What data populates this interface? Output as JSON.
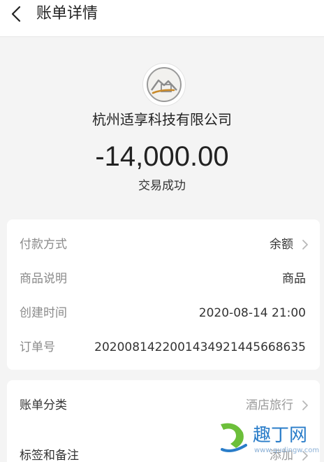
{
  "header": {
    "title": "账单详情"
  },
  "merchant": {
    "name": "杭州适享科技有限公司",
    "amount": "-14,000.00",
    "status": "交易成功"
  },
  "details": [
    {
      "label": "付款方式",
      "value": "余额"
    },
    {
      "label": "商品说明",
      "value": "商品"
    },
    {
      "label": "创建时间",
      "value": "2020-08-14 21:00"
    },
    {
      "label": "订单号",
      "value": "2020081422001434921445668635"
    }
  ],
  "extras": [
    {
      "label": "账单分类",
      "value": "酒店旅行"
    },
    {
      "label": "标签和备注",
      "value": "添加"
    }
  ],
  "watermark": {
    "text": "趣丁网",
    "url": "www.qudingw.com"
  },
  "icons": {
    "back": "chevron-left-icon",
    "row_chevron": "chevron-right-icon",
    "logo": "merchant-logo"
  },
  "colors": {
    "background": "#f4f4f4",
    "card": "#ffffff",
    "label": "#8a8a8a",
    "text": "#333333",
    "watermark": "#2a7dc9"
  }
}
